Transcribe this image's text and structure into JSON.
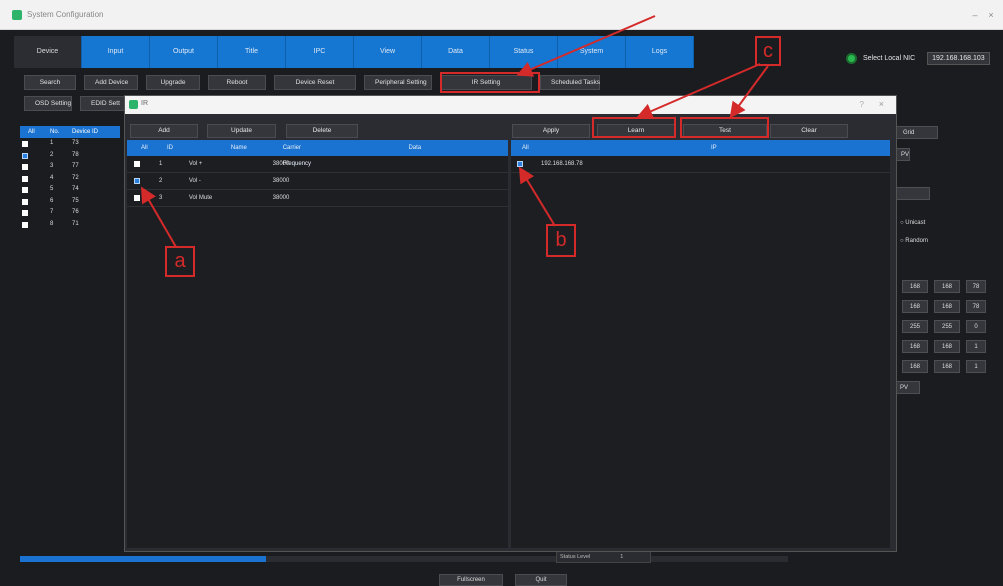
{
  "window": {
    "title": "System Configuration",
    "min_label": "–",
    "close_label": "×"
  },
  "tabs": [
    "Device",
    "Input",
    "Output",
    "Title",
    "IPC",
    "View",
    "Data",
    "Status",
    "System",
    "Logs"
  ],
  "nic": {
    "label": "Select Local NIC",
    "value": "192.168.168.103"
  },
  "toolbar1": [
    "Search",
    "Add Device",
    "Upgrade",
    "Reboot",
    "Device Reset",
    "Peripheral Setting",
    "IR Setting",
    "Scheduled Tasks"
  ],
  "toolbar2": [
    "OSD Setting",
    "EDID Sett"
  ],
  "device_table": {
    "headers": [
      "All",
      "No.",
      "Device ID"
    ],
    "rows": [
      {
        "no": "1",
        "id": "73",
        "checked": false
      },
      {
        "no": "2",
        "id": "78",
        "checked": true
      },
      {
        "no": "3",
        "id": "77",
        "checked": false
      },
      {
        "no": "4",
        "id": "72",
        "checked": false
      },
      {
        "no": "5",
        "id": "74",
        "checked": false
      },
      {
        "no": "6",
        "id": "75",
        "checked": false
      },
      {
        "no": "7",
        "id": "76",
        "checked": false
      },
      {
        "no": "8",
        "id": "71",
        "checked": false
      }
    ]
  },
  "right_side": {
    "grid_label": "Grid",
    "pv_label": "PV",
    "unicast": "Unicast",
    "random": "Random",
    "ip_rows": [
      [
        "168",
        "168",
        "78"
      ],
      [
        "168",
        "168",
        "78"
      ],
      [
        "255",
        "255",
        "0"
      ],
      [
        "168",
        "168",
        "1"
      ],
      [
        "168",
        "168",
        "1"
      ]
    ],
    "pv2": "PV"
  },
  "status": {
    "text": "Status Level",
    "value": "1",
    "progress": 0.32
  },
  "bottom": {
    "fullscreen": "Fullscreen",
    "quit": "Quit"
  },
  "dialog": {
    "title": "IR",
    "help": "?",
    "close": "×",
    "left_buttons": [
      "Add",
      "Update",
      "Delete"
    ],
    "left_headers": [
      "All",
      "ID",
      "Name",
      "Carrier Frequency",
      "Data"
    ],
    "left_rows": [
      {
        "id": "1",
        "name": "Vol +",
        "freq": "38000",
        "checked": false
      },
      {
        "id": "2",
        "name": "Vol -",
        "freq": "38000",
        "checked": true
      },
      {
        "id": "3",
        "name": "Vol Mute",
        "freq": "38000",
        "checked": false
      }
    ],
    "right_buttons": [
      "Apply",
      "Learn",
      "Test",
      "Clear"
    ],
    "right_headers": [
      "All",
      "IP"
    ],
    "right_rows": [
      {
        "ip": "192.168.168.78",
        "checked": true
      }
    ]
  },
  "annotations": {
    "a": "a",
    "b": "b",
    "c": "c",
    "color": "#d42a2a"
  }
}
